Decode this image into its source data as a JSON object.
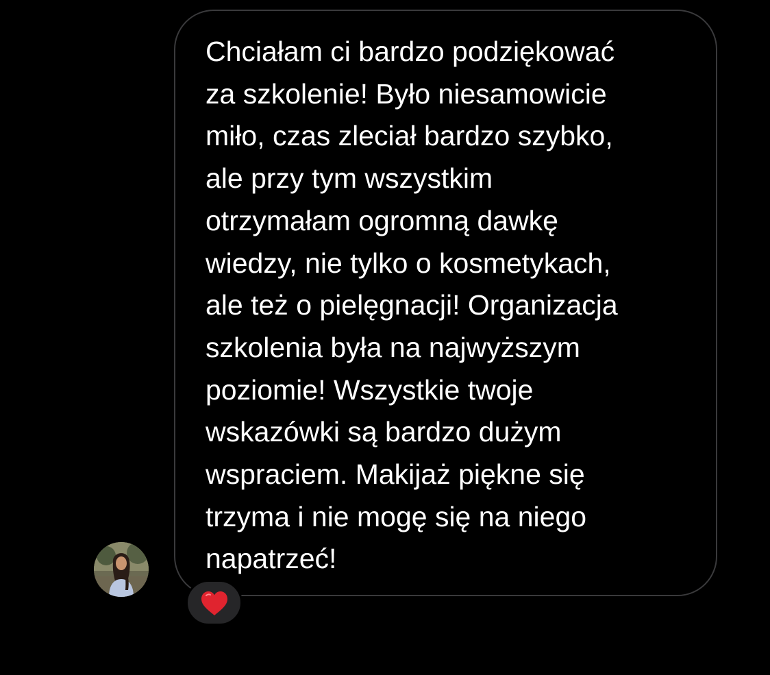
{
  "message": {
    "lines": [
      "Chciałam ci bardzo podziękować",
      "za szkolenie! Było niesamowicie",
      "miło, czas zleciał bardzo szybko,",
      "ale przy tym wszystkim",
      "otrzymałam ogromną dawkę",
      "wiedzy, nie tylko o kosmetykach,",
      "ale też o pielęgnacji! Organizacja",
      "szkolenia była na najwyższym",
      "poziomie! Wszystkie twoje",
      "wskazówki są bardzo dużym",
      "wspraciem. Makijaż piękne się",
      "trzyma i nie mogę się na niego",
      "napatrzeć!"
    ],
    "text_color": "#ffffff",
    "bubble_border_color": "#3a3a3c"
  },
  "sender": {
    "avatar_icon": "profile-photo"
  },
  "reaction": {
    "icon": "red-heart-icon",
    "color": "#e0242f",
    "pill_color": "#262628"
  },
  "theme": {
    "background": "#000000"
  }
}
